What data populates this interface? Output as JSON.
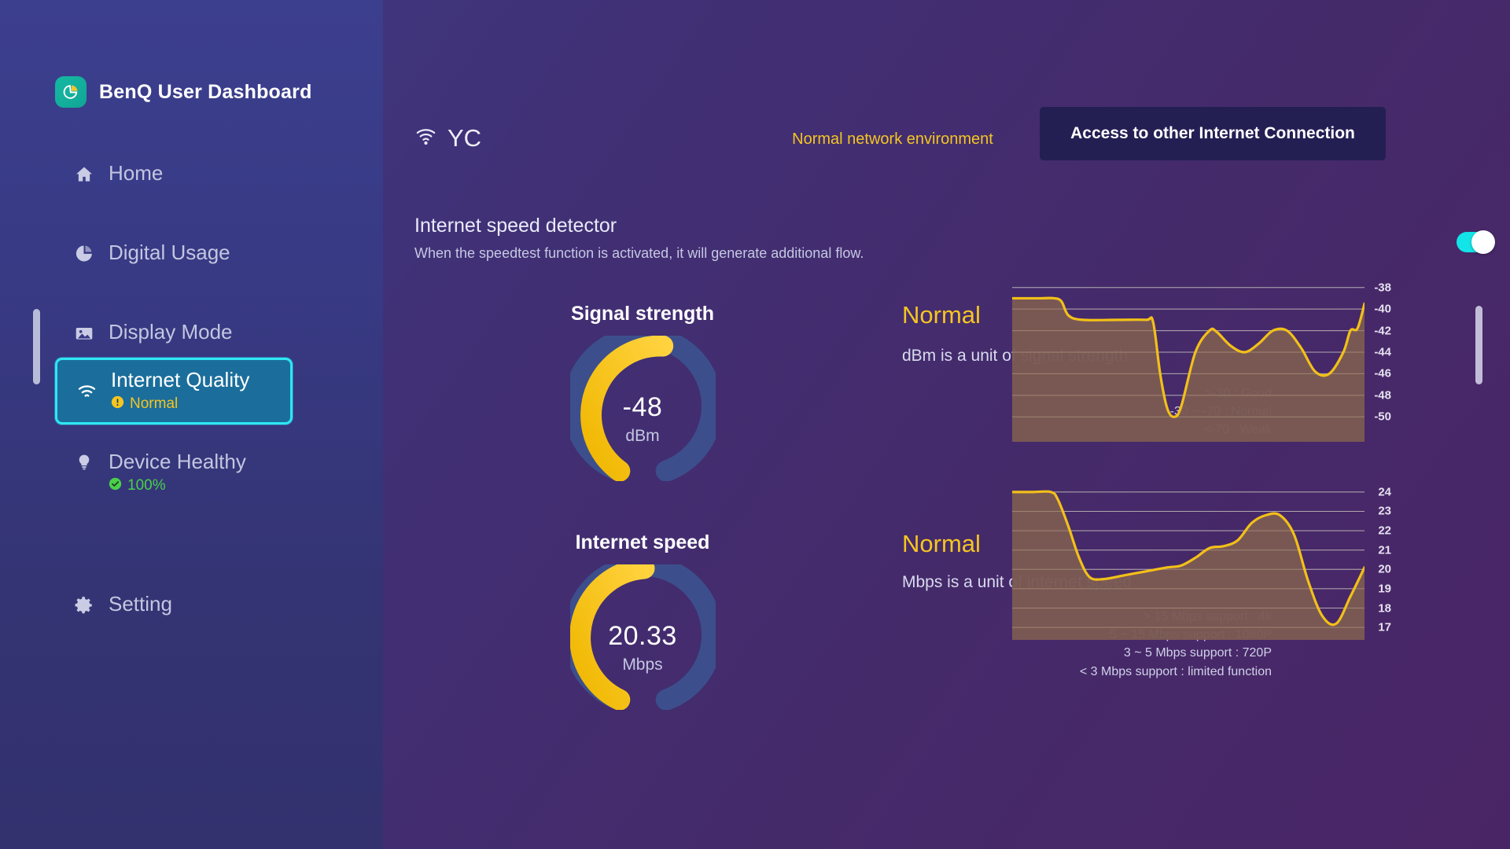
{
  "brand": {
    "title": "BenQ User Dashboard",
    "logo_icon": "pie-chart-icon"
  },
  "sidebar": {
    "items": [
      {
        "label": "Home",
        "icon": "home-icon",
        "active": false
      },
      {
        "label": "Digital Usage",
        "icon": "pie-chart-icon",
        "active": false
      },
      {
        "label": "Display Mode",
        "icon": "image-icon",
        "active": false
      },
      {
        "label": "Internet Quality",
        "icon": "wifi-icon",
        "active": true,
        "status": "Normal",
        "status_icon": "warning-icon",
        "status_color": "#f5c521"
      },
      {
        "label": "Device Healthy",
        "icon": "bulb-icon",
        "active": false,
        "status": "100%",
        "status_icon": "check-circle-icon",
        "status_color": "#4ad04a"
      },
      {
        "label": "Setting",
        "icon": "gear-icon",
        "active": false
      }
    ]
  },
  "header": {
    "ssid": "YC",
    "ssid_icon": "wifi-icon",
    "network_status": "Normal network environment",
    "access_button": "Access to other Internet Connection"
  },
  "detector": {
    "title": "Internet speed detector",
    "subtitle": "When the speedtest function is activated, it will generate additional flow.",
    "toggle_on": true
  },
  "signal": {
    "title": "Signal strength",
    "value": "-48",
    "unit": "dBm",
    "state": "Normal",
    "description": "dBm is a unit of signal strength",
    "legend": [
      ">-30 : Good",
      "-30 ~ -70 : Normal",
      "<-70 : Weak"
    ]
  },
  "speed": {
    "title": "Internet speed",
    "value": "20.33",
    "unit": "Mbps",
    "state": "Normal",
    "description": "Mbps is a unit of internet speed",
    "legend": [
      "> 15 Mbps support : 4k",
      "5 ~ 15 Mbps support : 1080P",
      "3 ~ 5 Mbps support : 720P",
      "< 3 Mbps support : limited function"
    ]
  },
  "colors": {
    "accent_yellow": "#f5c521",
    "accent_cyan": "#2fe6f5",
    "sidebar_active": "#1b6e9b",
    "chart_line": "#f2c018",
    "chart_fill": "#7b5a54"
  },
  "chart_data": [
    {
      "type": "area",
      "name": "signal-strength-history",
      "title": "",
      "xlabel": "",
      "ylabel": "dBm",
      "ytick_labels": [
        "-38",
        "-40",
        "-42",
        "-44",
        "-46",
        "-48",
        "-50"
      ],
      "ylim": [
        -51,
        -37
      ],
      "grid": true,
      "x": [
        0,
        4,
        8,
        12,
        14,
        16,
        20,
        30,
        38,
        40,
        42,
        44,
        46,
        48,
        52,
        56,
        58,
        62,
        66,
        70,
        74,
        78,
        82,
        86,
        90,
        94,
        96,
        98,
        100
      ],
      "values": [
        -39,
        -39,
        -39,
        -39,
        -39.3,
        -40.6,
        -41,
        -41,
        -41,
        -41.2,
        -46,
        -49.2,
        -50,
        -49,
        -44,
        -42,
        -42.1,
        -43.4,
        -44,
        -43.2,
        -42,
        -42,
        -43.6,
        -45.8,
        -46,
        -44,
        -42,
        -41.8,
        -39.5
      ]
    },
    {
      "type": "area",
      "name": "internet-speed-history",
      "title": "",
      "xlabel": "",
      "ylabel": "Mbps",
      "ytick_labels": [
        "24",
        "23",
        "22",
        "21",
        "20",
        "19",
        "18",
        "17"
      ],
      "ylim": [
        16.6,
        24.4
      ],
      "grid": true,
      "x": [
        0,
        6,
        11,
        13,
        16,
        19,
        22,
        26,
        32,
        38,
        44,
        48,
        52,
        56,
        60,
        64,
        68,
        72,
        76,
        80,
        84,
        88,
        92,
        96,
        100
      ],
      "values": [
        24,
        24,
        24,
        23.6,
        22.2,
        20.6,
        19.6,
        19.5,
        19.7,
        19.9,
        20.1,
        20.2,
        20.6,
        21.1,
        21.2,
        21.5,
        22.4,
        22.8,
        22.8,
        21.8,
        19.4,
        17.6,
        17.2,
        18.6,
        20.1
      ]
    }
  ]
}
